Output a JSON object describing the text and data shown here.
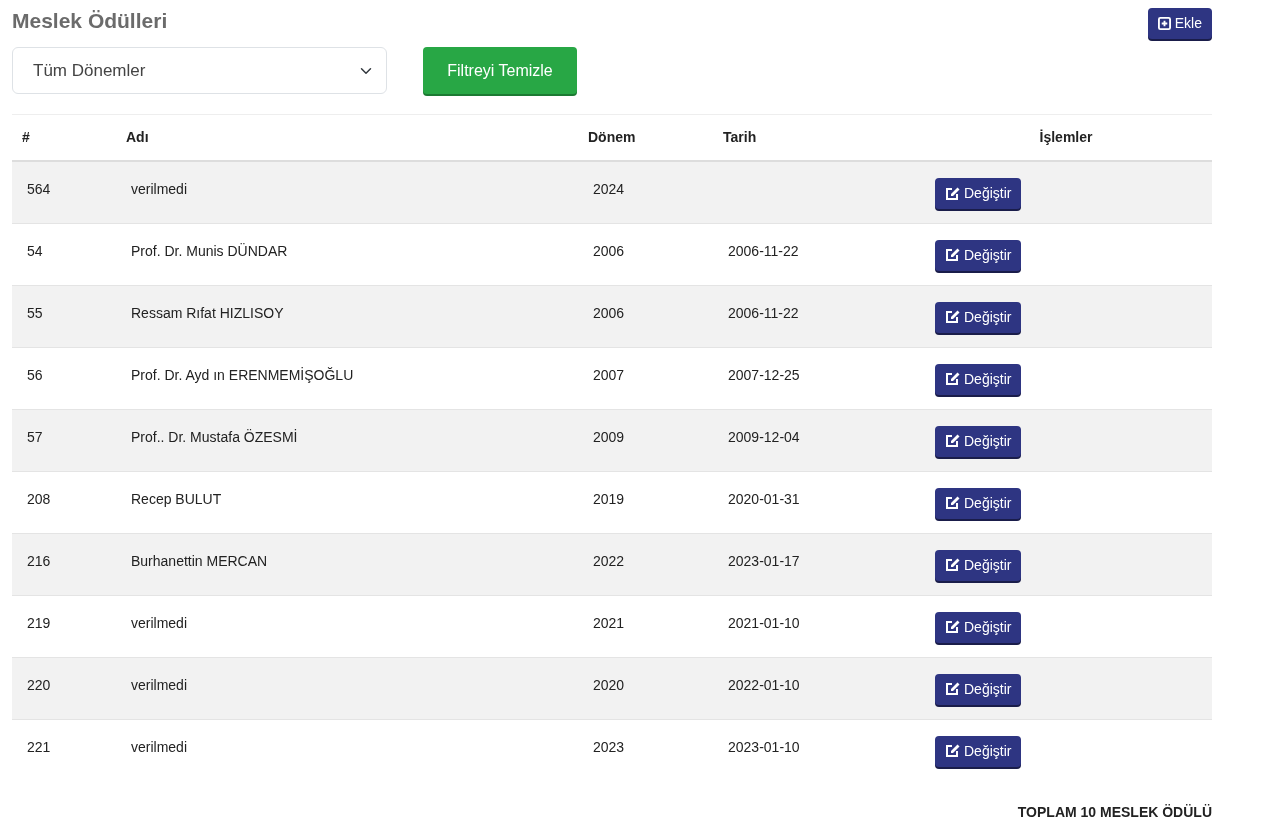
{
  "title": "Meslek Ödülleri",
  "add_button": {
    "label": "Ekle"
  },
  "period_filter": {
    "value": "Tüm Dönemler"
  },
  "clear_filter_button": {
    "label": "Filtreyi Temizle"
  },
  "table": {
    "columns": [
      "#",
      "Adı",
      "Dönem",
      "Tarih",
      "İşlemler"
    ],
    "rows": [
      {
        "id": "564",
        "name": "verilmedi",
        "period": "2024",
        "action": "Değiştir"
      },
      {
        "id": "54",
        "name": "Prof. Dr. Munis DÜNDAR",
        "period": "2006",
        "date": "2006-11-22",
        "action": "Değiştir"
      },
      {
        "id": "55",
        "name": "Ressam Rıfat HIZLISOY",
        "period": "2006",
        "date": "2006-11-22",
        "action": "Değiştir"
      },
      {
        "id": "56",
        "name": "Prof. Dr. Ayd ın ERENMEMİŞOĞLU",
        "period": "2007",
        "date": "2007-12-25",
        "action": "Değiştir"
      },
      {
        "id": "57",
        "name": "Prof.. Dr. Mustafa ÖZESMİ",
        "period": "2009",
        "date": "2009-12-04",
        "action": "Değiştir"
      },
      {
        "id": "208",
        "name": "Recep BULUT",
        "period": "2019",
        "date": "2020-01-31",
        "action": "Değiştir"
      },
      {
        "id": "216",
        "name": "Burhanettin MERCAN",
        "period": "2022",
        "date": "2023-01-17",
        "action": "Değiştir"
      },
      {
        "id": "219",
        "name": "verilmedi",
        "period": "2021",
        "date": "2021-01-10",
        "action": "Değiştir"
      },
      {
        "id": "220",
        "name": "verilmedi",
        "period": "2020",
        "date": "2022-01-10",
        "action": "Değiştir"
      },
      {
        "id": "221",
        "name": "verilmedi",
        "period": "2023",
        "date": "2023-01-10",
        "action": "Değiştir"
      }
    ]
  },
  "total": "TOPLAM 10 MESLEK ÖDÜLÜ"
}
